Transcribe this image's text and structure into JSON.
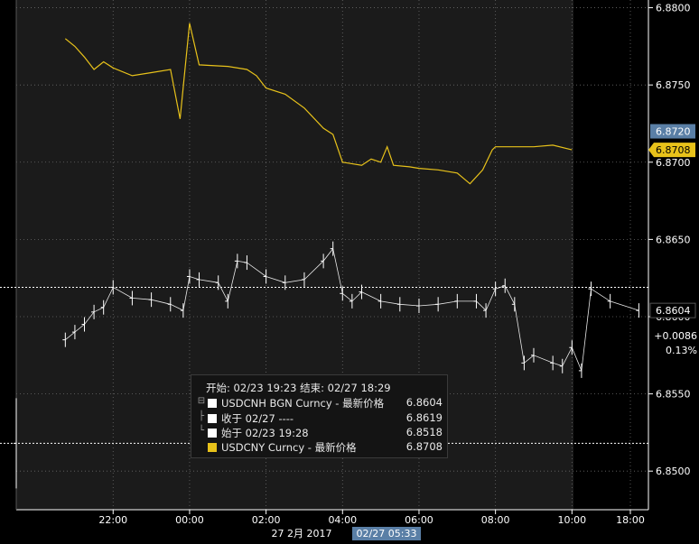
{
  "chart_data": {
    "type": "line",
    "title": "",
    "xlabel": "",
    "ylabel": "",
    "ylim": [
      6.8475,
      6.8805
    ],
    "y_ticks": [
      "6.8800",
      "6.8750",
      "6.8700",
      "6.8650",
      "6.8600",
      "6.8550",
      "6.8500"
    ],
    "x_tick_labels": [
      "22:00",
      "00:00",
      "02:00",
      "04:00",
      "06:00",
      "08:00",
      "10:00",
      "18:00"
    ],
    "date_label": "27 2月 2017",
    "cursor_time": "02/27 05:33",
    "grid": true,
    "reference_lines": [
      6.8619,
      6.8518
    ],
    "series": [
      {
        "name": "USDCNY Curncy",
        "kind": "line",
        "color": "#e8c21a",
        "points": [
          [
            "02/27 20:45",
            6.878
          ],
          [
            "02/27 21:00",
            6.8775
          ],
          [
            "02/27 21:15",
            6.8768
          ],
          [
            "02/27 21:30",
            6.876
          ],
          [
            "02/27 21:45",
            6.8765
          ],
          [
            "02/27 22:00",
            6.8761
          ],
          [
            "02/27 22:30",
            6.8756
          ],
          [
            "02/27 23:00",
            6.8758
          ],
          [
            "02/27 23:30",
            6.876
          ],
          [
            "02/27 23:45",
            6.8728
          ],
          [
            "02/28 00:00",
            6.879
          ],
          [
            "02/28 00:15",
            6.8763
          ],
          [
            "02/28 01:00",
            6.8762
          ],
          [
            "02/28 01:30",
            6.876
          ],
          [
            "02/28 01:45",
            6.8756
          ],
          [
            "02/28 02:00",
            6.8748
          ],
          [
            "02/28 02:30",
            6.8744
          ],
          [
            "02/28 03:00",
            6.8735
          ],
          [
            "02/28 03:30",
            6.8722
          ],
          [
            "02/28 03:45",
            6.8718
          ],
          [
            "02/28 04:00",
            6.87
          ],
          [
            "02/28 04:30",
            6.8698
          ],
          [
            "02/28 04:45",
            6.8702
          ],
          [
            "02/28 05:00",
            6.87
          ],
          [
            "02/28 05:10",
            6.871
          ],
          [
            "02/28 05:20",
            6.8698
          ],
          [
            "02/28 05:45",
            6.8697
          ],
          [
            "02/28 06:00",
            6.8696
          ],
          [
            "02/28 06:30",
            6.8695
          ],
          [
            "02/28 07:00",
            6.8693
          ],
          [
            "02/28 07:20",
            6.8686
          ],
          [
            "02/28 07:40",
            6.8695
          ],
          [
            "02/28 07:55",
            6.8708
          ],
          [
            "02/28 08:00",
            6.871
          ],
          [
            "02/28 09:00",
            6.871
          ],
          [
            "02/28 09:30",
            6.8711
          ],
          [
            "02/28 10:00",
            6.8708
          ]
        ]
      },
      {
        "name": "USDCNH BGN Curncy - 最新价格",
        "kind": "ohlc",
        "color": "#ffffff",
        "points": [
          [
            "02/27 19:28",
            6.8518
          ],
          [
            "02/27 20:45",
            6.8585
          ],
          [
            "02/27 21:00",
            6.859
          ],
          [
            "02/27 21:15",
            6.8595
          ],
          [
            "02/27 21:30",
            6.8603
          ],
          [
            "02/27 21:45",
            6.8606
          ],
          [
            "02/27 22:00",
            6.8619
          ],
          [
            "02/27 22:30",
            6.8612
          ],
          [
            "02/27 23:00",
            6.8611
          ],
          [
            "02/27 23:30",
            6.8608
          ],
          [
            "02/27 23:50",
            6.8604
          ],
          [
            "02/28 00:00",
            6.8626
          ],
          [
            "02/28 00:15",
            6.8624
          ],
          [
            "02/28 00:45",
            6.8622
          ],
          [
            "02/28 01:00",
            6.861
          ],
          [
            "02/28 01:15",
            6.8636
          ],
          [
            "02/28 01:30",
            6.8635
          ],
          [
            "02/28 02:00",
            6.8626
          ],
          [
            "02/28 02:30",
            6.8622
          ],
          [
            "02/28 03:00",
            6.8624
          ],
          [
            "02/28 03:30",
            6.8636
          ],
          [
            "02/28 03:45",
            6.8644
          ],
          [
            "02/28 04:00",
            6.8615
          ],
          [
            "02/28 04:15",
            6.861
          ],
          [
            "02/28 04:30",
            6.8616
          ],
          [
            "02/28 05:00",
            6.861
          ],
          [
            "02/28 05:30",
            6.8608
          ],
          [
            "02/28 06:00",
            6.8607
          ],
          [
            "02/28 06:30",
            6.8608
          ],
          [
            "02/28 07:00",
            6.861
          ],
          [
            "02/28 07:30",
            6.861
          ],
          [
            "02/28 07:45",
            6.8604
          ],
          [
            "02/28 08:00",
            6.8618
          ],
          [
            "02/28 08:15",
            6.862
          ],
          [
            "02/28 08:30",
            6.8608
          ],
          [
            "02/28 08:45",
            6.857
          ],
          [
            "02/28 09:00",
            6.8575
          ],
          [
            "02/28 09:30",
            6.857
          ],
          [
            "02/28 09:45",
            6.8568
          ],
          [
            "02/28 10:00",
            6.858
          ],
          [
            "02/28 10:15",
            6.8565
          ],
          [
            "02/28 10:30",
            6.8618
          ],
          [
            "02/28 11:00",
            6.861
          ],
          [
            "02/28 11:45",
            6.8604
          ]
        ]
      }
    ],
    "axis_markers": [
      {
        "label": "6.8720",
        "value": 6.872,
        "bg": "#5a7fa6",
        "fg": "#ffffff"
      },
      {
        "label": "6.8708",
        "value": 6.8708,
        "bg": "#e8c21a",
        "fg": "#000000"
      },
      {
        "label": "6.8604",
        "value": 6.8604,
        "bg": "#000000",
        "fg": "#ffffff"
      }
    ],
    "change_abs": "+0.0086",
    "change_pct": "0.13%",
    "legend": {
      "header": "开始: 02/23 19:23 结束: 02/27 18:29",
      "entries": [
        {
          "tree": "⊟",
          "name": "USDCNH BGN Curncy - 最新价格",
          "value": "6.8604",
          "swatch": "#ffffff"
        },
        {
          "tree": "├",
          "name": "收于 02/27 ----",
          "value": "6.8619",
          "swatch": "#ffffff"
        },
        {
          "tree": "└",
          "name": "始于 02/23 19:28",
          "value": "6.8518",
          "swatch": "#ffffff"
        },
        {
          "tree": "",
          "name": "USDCNY Curncy - 最新价格",
          "value": "6.8708",
          "swatch": "#e8c21a"
        }
      ]
    }
  },
  "colors": {
    "background": "#000000",
    "session_band": "#1b1b1b",
    "grid": "#6a6a6a",
    "axis_text": "#ffffff",
    "cny_line": "#e8c21a",
    "cnh_bars": "#ffffff",
    "cursor_label_bg": "#5a7fa6"
  }
}
